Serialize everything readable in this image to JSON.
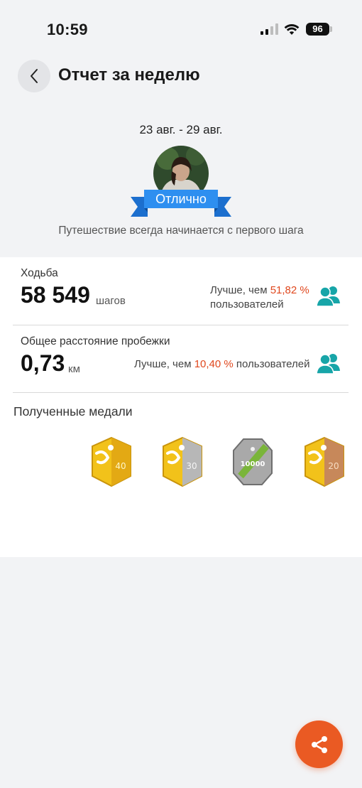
{
  "status_bar": {
    "time": "10:59",
    "battery": "96"
  },
  "header": {
    "title": "Отчет за неделю",
    "back_icon": "chevron-left-icon"
  },
  "summary": {
    "date_range": "23 авг. - 29 авг.",
    "badge": "Отлично",
    "motto": "Путешествие всегда начинается с первого шага"
  },
  "walking": {
    "label": "Ходьба",
    "value": "58 549",
    "unit": "шагов",
    "compare_prefix": "Лучше, чем",
    "compare_pct": "51,82 %",
    "compare_suffix": "пользователей"
  },
  "running": {
    "label": "Общее расстояние пробежки",
    "value": "0,73",
    "unit": "км",
    "compare_prefix": "Лучше, чем",
    "compare_pct": "10,40 %",
    "compare_suffix": "пользователей"
  },
  "medals": {
    "title": "Полученные медали",
    "items": [
      {
        "icon": "gold-medal-icon",
        "text": "40"
      },
      {
        "icon": "silver-gold-medal-icon",
        "text": "30"
      },
      {
        "icon": "silver-medal-icon",
        "text": "10000"
      },
      {
        "icon": "bronze-gold-medal-icon",
        "text": "20"
      }
    ]
  },
  "colors": {
    "accent": "#ea5a23",
    "highlight": "#e0481e",
    "teal": "#17a5a8",
    "ribbon": "#2e8ff0",
    "background": "#f2f3f5"
  },
  "share_icon": "share-icon"
}
